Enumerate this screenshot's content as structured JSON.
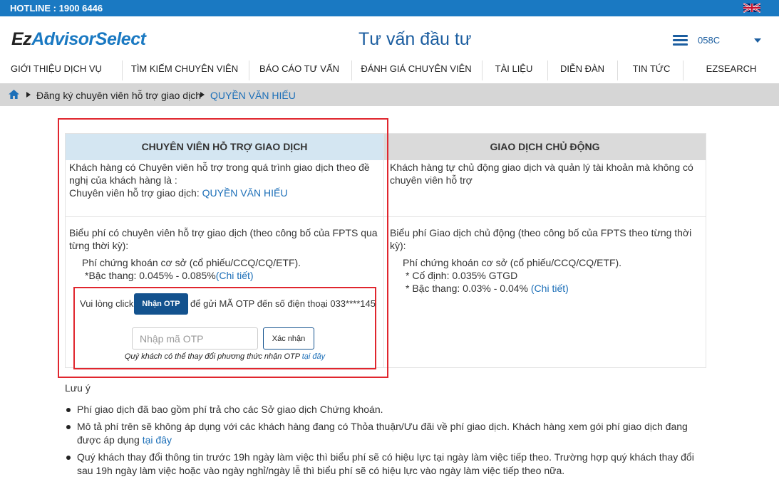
{
  "topbar": {
    "hotline": "HOTLINE : 1900 6446"
  },
  "header": {
    "logo_ez": "Ez",
    "logo_advisor": "AdvisorSelect",
    "page_title": "Tư vấn đầu tư",
    "user": "058C"
  },
  "nav": {
    "items": [
      "GIỚI THIỆU DỊCH VỤ",
      "TÌM KIẾM CHUYÊN VIÊN",
      "BÁO CÁO TƯ VẤN",
      "ĐÁNH GIÁ CHUYÊN VIÊN",
      "TÀI LIỆU",
      "DIỄN ĐÀN",
      "TIN TỨC",
      "EZSEARCH"
    ]
  },
  "breadcrumb": {
    "step": "Đăng ký chuyên viên hỗ trợ giao dịch",
    "current": "QUYỀN VĂN HIẾU"
  },
  "left_panel": {
    "title": "CHUYÊN VIÊN HỖ TRỢ GIAO DỊCH",
    "desc": "Khách hàng có Chuyên viên hỗ trợ trong quá trình giao dịch theo đề nghị của khách hàng là :",
    "advisor_label": "Chuyên viên hỗ trợ giao dịch:",
    "advisor_name": "QUYỀN VĂN HIẾU",
    "fee_title": "Biểu phí có chuyên viên hỗ trợ giao dịch (theo công bố của FPTS qua từng thời kỳ):",
    "fee_base": "Phí chứng khoán cơ sở (cổ phiếu/CCQ/CQ/ETF).",
    "fee_tier": "*Bậc thang: 0.045% - 0.085%",
    "detail_link": "(Chi tiết)"
  },
  "right_panel": {
    "title": "GIAO DỊCH CHỦ ĐỘNG",
    "desc": "Khách hàng tự chủ động giao dịch và quản lý tài khoản mà không có chuyên viên hỗ trợ",
    "fee_title": "Biểu phí Giao dịch chủ động (theo công bố của FPTS theo từng thời kỳ):",
    "fee_base": "Phí chứng khoán cơ sở (cổ phiếu/CCQ/CQ/ETF).",
    "fee_fixed": "* Cố định: 0.035% GTGD",
    "fee_tier": "* Bậc thang: 0.03% - 0.04%",
    "detail_link": "(Chi tiết)"
  },
  "otp": {
    "prefix": "Vui lòng click",
    "button": "Nhận OTP",
    "suffix": "để gửi MÃ OTP đến số điện thoại 033****145",
    "placeholder": "Nhập mã OTP",
    "confirm": "Xác nhận",
    "note": "Quý khách có thể thay đổi phương thức nhận OTP",
    "note_link": "tại đây"
  },
  "notes": {
    "title": "Lưu ý",
    "item1": "Phí giao dịch đã bao gồm phí trả cho các Sở giao dịch Chứng khoán.",
    "item2": "Mô tả phí trên sẽ không áp dụng với các khách hàng đang có Thỏa thuận/Ưu đãi về phí giao dịch. Khách hàng xem gói phí giao dịch đang được áp dụng",
    "item2_link": "tại đây",
    "item3": "Quý khách thay đổi thông tin trước 19h ngày làm việc thì biểu phí sẽ có hiệu lực tại ngày làm việc tiếp theo. Trường hợp quý khách thay đổi sau 19h ngày làm việc hoặc vào ngày nghỉ/ngày lễ thì biểu phí sẽ có hiệu lực vào ngày làm việc tiếp theo nữa."
  }
}
